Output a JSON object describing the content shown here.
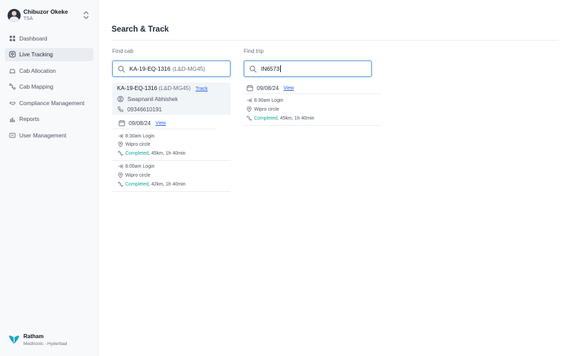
{
  "user": {
    "name": "Chibuzor Okeke",
    "role": "TSA"
  },
  "nav": [
    {
      "label": "Dashboard",
      "icon": "grid-icon"
    },
    {
      "label": "Live Tracking",
      "icon": "tracking-icon",
      "active": true
    },
    {
      "label": "Cab Allocation",
      "icon": "car-icon"
    },
    {
      "label": "Cab Mapping",
      "icon": "route-icon"
    },
    {
      "label": "Compliance Management",
      "icon": "compliance-icon"
    },
    {
      "label": "Reports",
      "icon": "chart-icon"
    },
    {
      "label": "User Management",
      "icon": "user-management-icon"
    }
  ],
  "org": {
    "name": "Ratham",
    "sub": "Medtronic - Hyderbad"
  },
  "page": {
    "title": "Search & Track"
  },
  "find_cab": {
    "label": "Find cab",
    "query": "KA-19-EQ-1316",
    "query_suffix": "(L&D-MG45)",
    "result": {
      "plate": "KA-19-EQ-1316",
      "code": "(L&D-MG45)",
      "track_label": "Track",
      "driver": "Swapnanil Abhishek",
      "phone": "09346610191"
    },
    "date": "09/08/24",
    "view_label": "View",
    "trips": [
      {
        "time": "8:30am Login",
        "place": "Wipro circle",
        "status": "Completed",
        "detail": ", 45km, 1h 40min"
      },
      {
        "time": "8:00am Login",
        "place": "Wipro circle",
        "status": "Completed",
        "detail": ", 42km, 1h 40min"
      }
    ]
  },
  "find_trip": {
    "label": "Find trip",
    "query": "IN6573",
    "date": "09/08/24",
    "view_label": "View",
    "trip": {
      "time": "8:30am Login",
      "place": "Wipro circle",
      "status": "Completed",
      "detail": ", 45km, 1h 40min"
    }
  },
  "colors": {
    "accent": "#2563eb",
    "success": "#0fa79a",
    "focus_border": "#5b9bd5"
  }
}
